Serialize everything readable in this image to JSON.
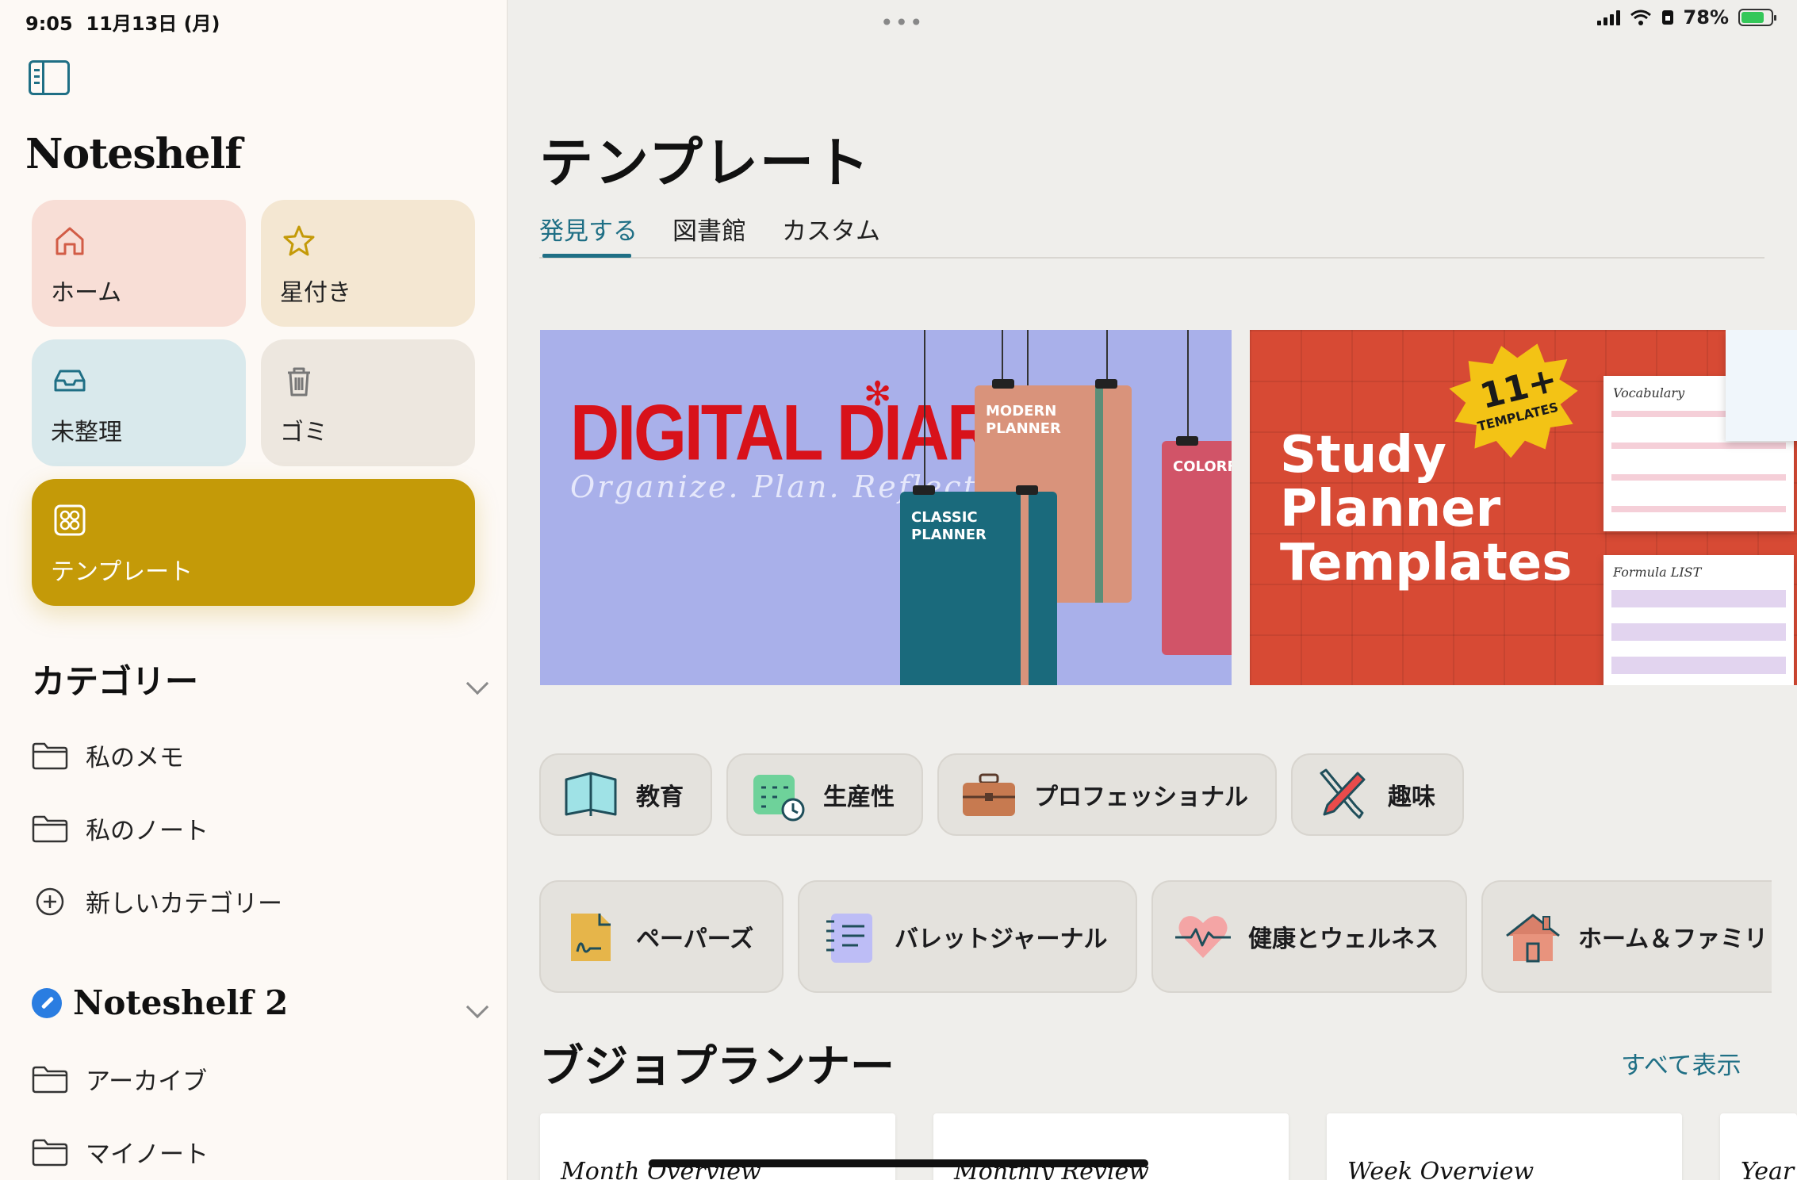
{
  "status": {
    "time": "9:05",
    "date": "11月13日 (月)",
    "battery": "78%",
    "battery_level": 0.78
  },
  "sidebar": {
    "app_title": "Noteshelf",
    "tiles": {
      "home": "ホーム",
      "starred": "星付き",
      "unfiled": "未整理",
      "trash": "ゴミ",
      "templates": "テンプレート"
    },
    "categories_title": "カテゴリー",
    "categories": [
      {
        "label": "私のメモ"
      },
      {
        "label": "私のノート"
      }
    ],
    "new_category": "新しいカテゴリー",
    "ns2_title": "Noteshelf 2",
    "ns2_items": [
      {
        "label": "アーカイブ"
      },
      {
        "label": "マイノート"
      }
    ]
  },
  "main": {
    "title": "テンプレート",
    "tabs": [
      {
        "label": "発見する"
      },
      {
        "label": "図書館"
      },
      {
        "label": "カスタム"
      }
    ],
    "banners": {
      "diaries": {
        "title": "DIGITAL DIARIES",
        "subtitle": "Organize. Plan. Reflect",
        "planners": [
          "CLASSIC PLANNER",
          "MODERN PLANNER",
          "COLORFUL PLANNER"
        ]
      },
      "study": {
        "title_lines": [
          "Study",
          "Planner",
          "Templates"
        ],
        "badge_num": "11+",
        "badge_sub": "TEMPLATES",
        "sheet1": "Vocabulary",
        "sheet2": "Formula LIST"
      }
    },
    "chips_row1": [
      {
        "label": "教育",
        "icon": "book-icon"
      },
      {
        "label": "生産性",
        "icon": "calendar-clock-icon"
      },
      {
        "label": "プロフェッショナル",
        "icon": "briefcase-icon"
      },
      {
        "label": "趣味",
        "icon": "pencil-brush-icon"
      }
    ],
    "chips_row2": [
      {
        "label": "ペーパーズ",
        "icon": "paper-signature-icon"
      },
      {
        "label": "バレットジャーナル",
        "icon": "notebook-icon"
      },
      {
        "label": "健康とウェルネス",
        "icon": "heart-pulse-icon"
      },
      {
        "label": "ホーム＆ファミリ",
        "icon": "house-icon"
      }
    ],
    "section_title": "ブジョプランナー",
    "see_all": "すべて表示",
    "cards": [
      {
        "title": "Month Overview"
      },
      {
        "title": "Monthly Review"
      },
      {
        "title": "Week Overview"
      },
      {
        "title": "Year"
      }
    ]
  },
  "colors": {
    "accent": "#1f6f85",
    "templates_tile": "#c49a08",
    "diaries_bg": "#a9b0ea",
    "study_bg": "#d74a34"
  }
}
